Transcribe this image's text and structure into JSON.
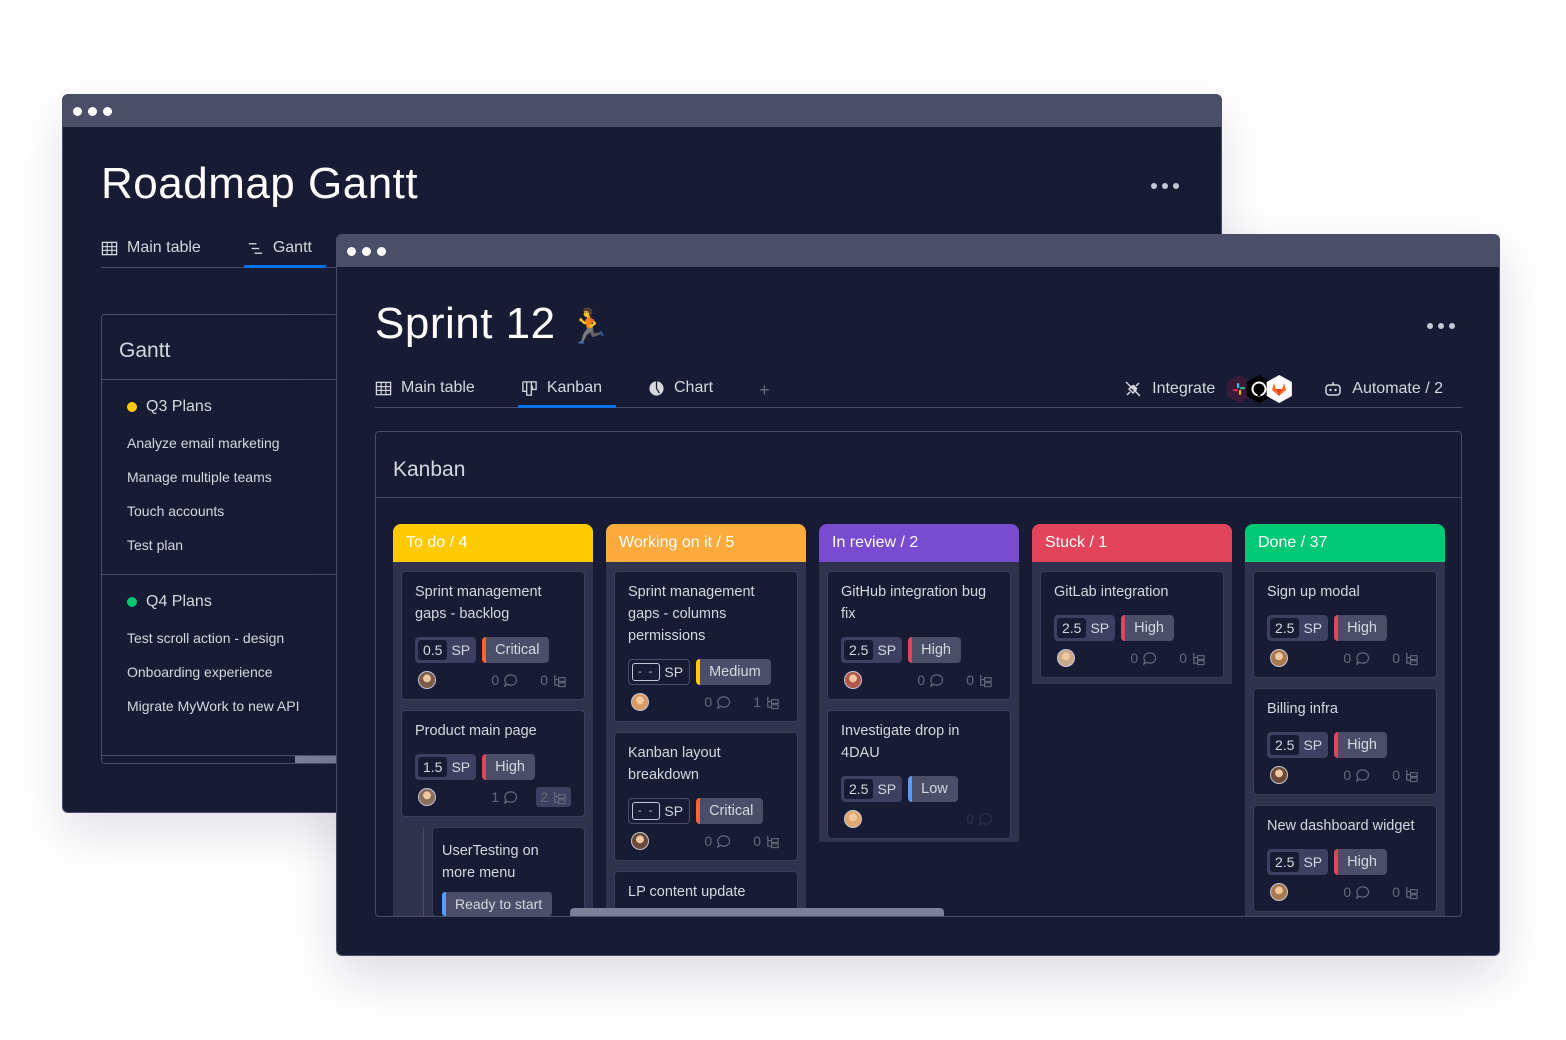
{
  "back_window": {
    "title": "Roadmap Gantt",
    "tabs": [
      {
        "label": "Main table",
        "icon": "table-icon",
        "active": false
      },
      {
        "label": "Gantt",
        "icon": "gantt-icon",
        "active": true
      }
    ],
    "panel_title": "Gantt",
    "groups": [
      {
        "name": "Q3 Plans",
        "color": "#ffcb00",
        "items": [
          "Analyze email marketing",
          "Manage multiple teams",
          "Touch accounts",
          "Test plan"
        ]
      },
      {
        "name": "Q4 Plans",
        "color": "#00c875",
        "items": [
          "Test scroll action - design",
          "Onboarding experience",
          "Migrate MyWork to new API"
        ]
      }
    ]
  },
  "front_window": {
    "title": "Sprint 12",
    "title_emoji": "🏃",
    "tabs": [
      {
        "label": "Main table",
        "icon": "table-icon",
        "active": false
      },
      {
        "label": "Kanban",
        "icon": "kanban-icon",
        "active": true
      },
      {
        "label": "Chart",
        "icon": "chart-icon",
        "active": false
      },
      {
        "label": "+",
        "icon": "add-view-icon",
        "active": false
      }
    ],
    "toolbar": {
      "integrate_label": "Integrate",
      "integrations": [
        "slack",
        "github",
        "gitlab"
      ],
      "automate_label": "Automate / 2"
    },
    "panel_title": "Kanban",
    "sp_unit": "SP",
    "columns": [
      {
        "label": "To do / 4",
        "color": "#ffcb00",
        "cards": [
          {
            "title": "Sprint management gaps - backlog",
            "sp": "0.5",
            "priority": "Critical",
            "priority_color": "#ff642e",
            "comments": "0",
            "subitems": "0",
            "avatar_color": "#7a5a4a"
          },
          {
            "title": "Product main page",
            "sp": "1.5",
            "priority": "High",
            "priority_color": "#e2445c",
            "comments": "1",
            "subitems": "2",
            "subitems_highlight": true,
            "avatar_color": "#8b6f5c",
            "subitem": {
              "title": "UserTesting on more menu",
              "status": "Ready to start",
              "status_color": "#579bfc"
            }
          }
        ]
      },
      {
        "label": "Working on it / 5",
        "color": "#fdab3d",
        "cards": [
          {
            "title": "Sprint management gaps - columns permissions",
            "sp": "- -",
            "sp_empty": true,
            "priority": "Medium",
            "priority_color": "#ffcb00",
            "comments": "0",
            "subitems": "1",
            "avatar_color": "#d99a66"
          },
          {
            "title": "Kanban layout breakdown",
            "sp": "- -",
            "sp_empty": true,
            "priority": "Critical",
            "priority_color": "#ff642e",
            "comments": "0",
            "subitems": "0",
            "avatar_color": "#6b4a3a"
          },
          {
            "title": "LP content update"
          }
        ]
      },
      {
        "label": "In review / 2",
        "color": "#784bd1",
        "cards": [
          {
            "title": "GitHub integration bug fix",
            "sp": "2.5",
            "priority": "High",
            "priority_color": "#e2445c",
            "comments": "0",
            "subitems": "0",
            "avatar_color": "#b3574a"
          },
          {
            "title": "Investigate drop in 4DAU",
            "sp": "2.5",
            "priority": "Low",
            "priority_color": "#579bfc",
            "comments": "0",
            "avatar_color": "#e0a86f",
            "faded_meta": true
          }
        ]
      },
      {
        "label": "Stuck / 1",
        "color": "#e2445c",
        "cards": [
          {
            "title": "GitLab integration",
            "sp": "2.5",
            "priority": "High",
            "priority_color": "#e2445c",
            "comments": "0",
            "subitems": "0",
            "avatar_color": "#c9a98a"
          }
        ]
      },
      {
        "label": "Done  / 37",
        "color": "#00c875",
        "cards": [
          {
            "title": "Sign up modal",
            "sp": "2.5",
            "priority": "High",
            "priority_color": "#e2445c",
            "comments": "0",
            "subitems": "0",
            "avatar_color": "#a87850"
          },
          {
            "title": "Billing infra",
            "sp": "2.5",
            "priority": "High",
            "priority_color": "#e2445c",
            "comments": "0",
            "subitems": "0",
            "avatar_color": "#6b4a3a"
          },
          {
            "title": "New dashboard widget",
            "sp": "2.5",
            "priority": "High",
            "priority_color": "#e2445c",
            "comments": "0",
            "subitems": "0",
            "avatar_color": "#a87850"
          }
        ]
      }
    ]
  }
}
